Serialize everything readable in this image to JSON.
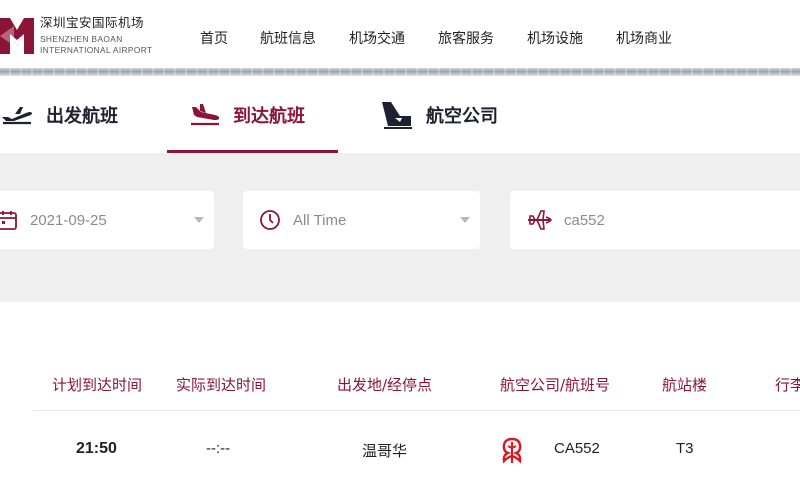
{
  "logo": {
    "name_cn": "深圳宝安国际机场",
    "name_en_line1": "SHENZHEN BAOAN",
    "name_en_line2": "INTERNATIONAL AIRPORT"
  },
  "nav": {
    "items": [
      "首页",
      "航班信息",
      "机场交通",
      "旅客服务",
      "机场设施",
      "机场商业"
    ]
  },
  "tabs": [
    {
      "label": "出发航班",
      "icon": "departure-plane-icon",
      "active": false
    },
    {
      "label": "到达航班",
      "icon": "arrival-plane-icon",
      "active": true
    },
    {
      "label": "航空公司",
      "icon": "airline-tail-icon",
      "active": false
    }
  ],
  "filter": {
    "date": "2021-09-25",
    "time": "All Time",
    "flight_no": "ca552"
  },
  "table": {
    "headers": [
      "计划到达时间",
      "实际到达时间",
      "出发地/经停点",
      "航空公司/航班号",
      "航站楼",
      "行李"
    ],
    "rows": [
      {
        "scheduled": "21:50",
        "actual": "--:--",
        "origin": "温哥华",
        "airline_logo": "air-china-logo",
        "flight": "CA552",
        "terminal": "T3"
      }
    ]
  },
  "colors": {
    "accent": "#8a1538",
    "panel_bg": "#efefef",
    "air_china_red": "#d71920"
  }
}
